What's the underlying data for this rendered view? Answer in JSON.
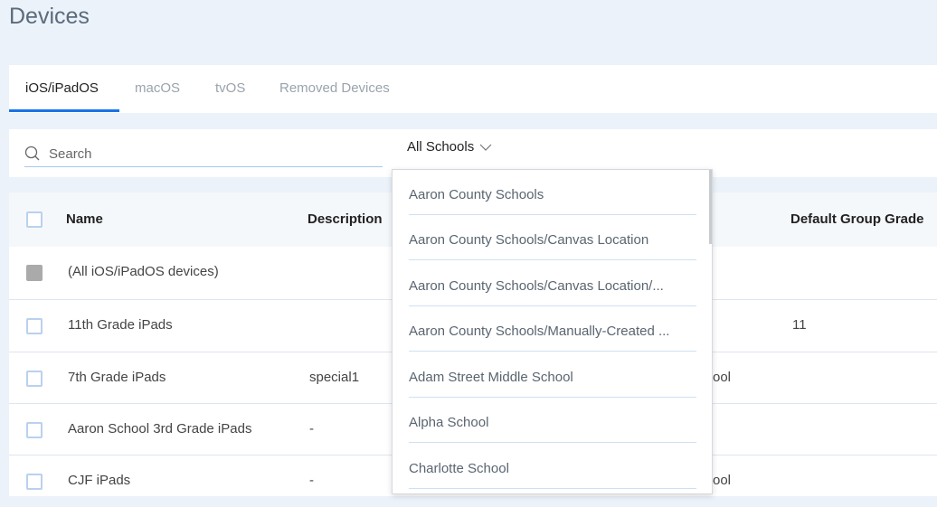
{
  "page": {
    "title": "Devices"
  },
  "tabs": [
    {
      "label": "iOS/iPadOS",
      "active": true
    },
    {
      "label": "macOS"
    },
    {
      "label": "tvOS"
    },
    {
      "label": "Removed Devices"
    }
  ],
  "filter": {
    "search_placeholder": "Search",
    "schools_selected": "All Schools"
  },
  "table": {
    "headers": {
      "name": "Name",
      "description": "Description",
      "default_group_grade": "Default Group Grade"
    },
    "rows": [
      {
        "name": "(All iOS/iPadOS devices)",
        "description": "",
        "hidden_partial": "",
        "grade": "",
        "checkbox": "disabled"
      },
      {
        "name": "11th Grade iPads",
        "description": "",
        "hidden_partial": "",
        "grade": "11"
      },
      {
        "name": "7th Grade iPads",
        "description": "special1",
        "hidden_partial": "ool",
        "grade": ""
      },
      {
        "name": "Aaron School 3rd Grade iPads",
        "description": "-",
        "hidden_partial": "",
        "grade": ""
      },
      {
        "name": "CJF iPads",
        "description": "-",
        "hidden_partial": "ool",
        "grade": ""
      }
    ]
  },
  "dropdown": {
    "options": [
      "Aaron County Schools",
      "Aaron County Schools/Canvas Location",
      "Aaron County Schools/Canvas Location/...",
      "Aaron County Schools/Manually-Created ...",
      "Adam Street Middle School",
      "Alpha School",
      "Charlotte School"
    ]
  },
  "colors": {
    "accent": "#1a73e8",
    "background": "#ebf2fa"
  }
}
